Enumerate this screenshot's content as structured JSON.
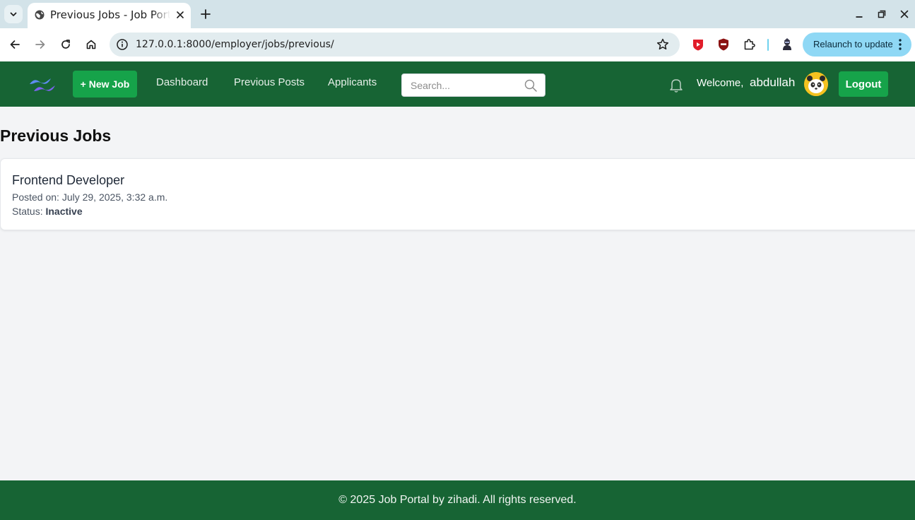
{
  "browser": {
    "tab_title": "Previous Jobs - Job Portal",
    "url": "127.0.0.1:8000/employer/jobs/previous/",
    "relaunch_label": "Relaunch to update"
  },
  "navbar": {
    "new_job_label": "+ New Job",
    "links": [
      "Dashboard",
      "Previous Posts",
      "Applicants"
    ],
    "search_placeholder": "Search...",
    "welcome_label": "Welcome,",
    "username": "abdullah",
    "logout_label": "Logout"
  },
  "page": {
    "title": "Previous Jobs",
    "jobs": [
      {
        "title": "Frontend Developer",
        "posted": "Posted on: July 29, 2025, 3:32 a.m.",
        "status_label": "Status:",
        "status_value": "Inactive"
      }
    ]
  },
  "footer": {
    "text": "© 2025 Job Portal by zihadi. All rights reserved."
  },
  "colors": {
    "navbar_bg": "#176434",
    "button_green": "#16a34a",
    "page_bg": "#f3f4f6"
  }
}
